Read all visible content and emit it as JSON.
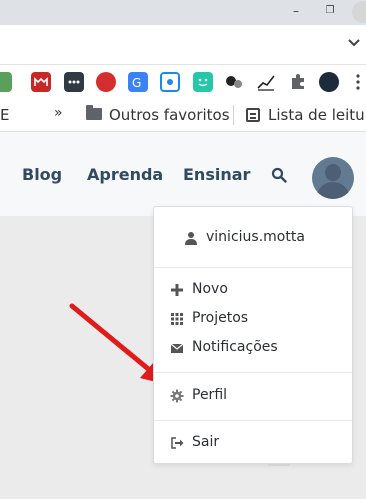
{
  "bookmarks": {
    "truncated_left": "E",
    "more_chevron": "»",
    "folder_label": "Outros favoritos",
    "reading_list_label": "Lista de leitura"
  },
  "window_controls": {
    "minimize": "–",
    "maximize": "❐"
  },
  "site_nav": {
    "blog": "Blog",
    "aprenda": "Aprenda",
    "ensinar": "Ensinar"
  },
  "user_menu": {
    "username": "vinicius.motta",
    "items": [
      {
        "label": "Novo",
        "icon": "plus-icon"
      },
      {
        "label": "Projetos",
        "icon": "grid-icon"
      },
      {
        "label": "Notificações",
        "icon": "envelope-icon"
      },
      {
        "label": "Perfil",
        "icon": "gear-icon"
      },
      {
        "label": "Sair",
        "icon": "sign-out-icon"
      }
    ]
  },
  "colors": {
    "nav_text": "#2f4a62",
    "annotation_arrow": "#e21a1a",
    "avatar_bg": "#637a93"
  }
}
